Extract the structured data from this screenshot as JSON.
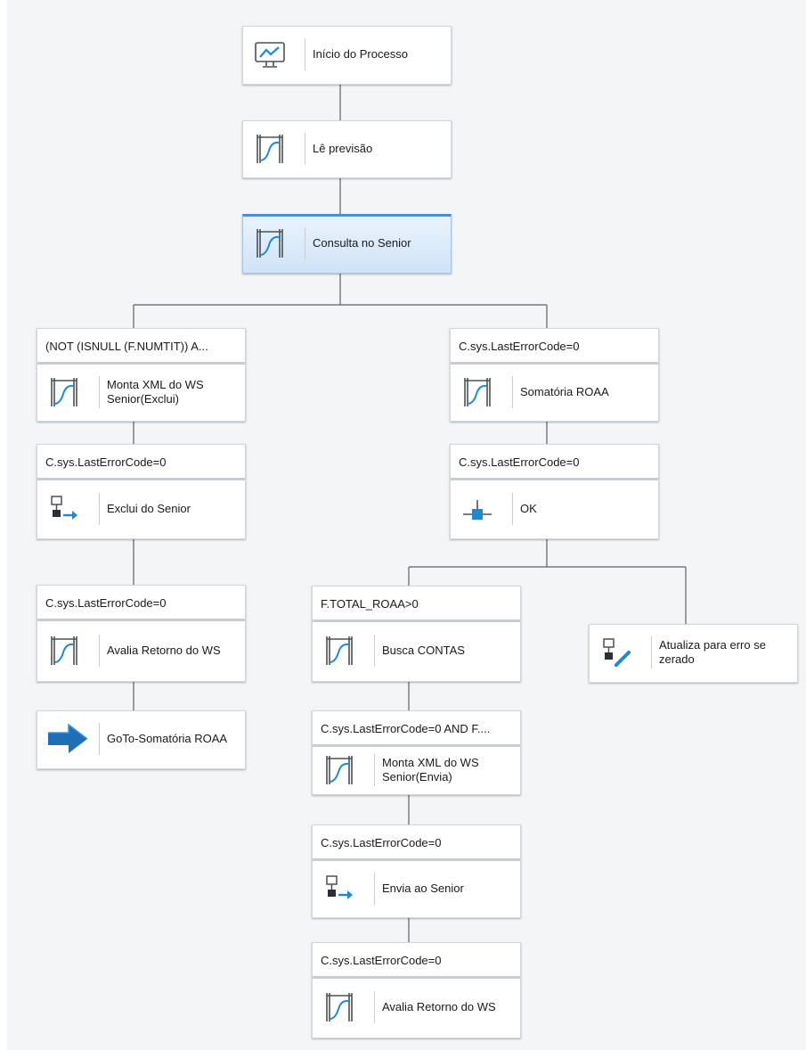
{
  "nodes": {
    "start": {
      "label": "Início do Processo",
      "icon": "monitor-chart-icon"
    },
    "le_previsao": {
      "label": "Lê previsão",
      "icon": "sql-gate-icon"
    },
    "consulta_senior": {
      "label": "Consulta no Senior",
      "icon": "sql-gate-icon"
    },
    "monta_xml_exclui": {
      "condition": "(NOT (ISNULL (F.NUMTIT)) A...",
      "label": "Monta XML do WS Senior(Exclui)",
      "icon": "sql-gate-icon"
    },
    "exclui_senior": {
      "condition": "C.sys.LastErrorCode=0",
      "label": "Exclui do Senior",
      "icon": "call-flow-icon"
    },
    "avalia_retorno_left": {
      "condition": "C.sys.LastErrorCode=0",
      "label": "Avalia Retorno do WS",
      "icon": "sql-gate-icon"
    },
    "goto_somatoria": {
      "label": "GoTo-Somatória ROAA",
      "icon": "goto-arrow-icon"
    },
    "somatoria_roaa": {
      "condition": "C.sys.LastErrorCode=0",
      "label": "Somatória ROAA",
      "icon": "sql-gate-icon"
    },
    "ok": {
      "condition": "C.sys.LastErrorCode=0",
      "label": "OK",
      "icon": "junction-icon"
    },
    "busca_contas": {
      "condition": "F.TOTAL_ROAA>0",
      "label": "Busca CONTAS",
      "icon": "sql-gate-icon"
    },
    "atualiza_erro": {
      "label": "Atualiza para erro se zerado",
      "icon": "edit-flow-icon"
    },
    "monta_xml_envia": {
      "condition": "C.sys.LastErrorCode=0 AND F....",
      "label": "Monta XML do WS Senior(Envia)",
      "icon": "sql-gate-icon"
    },
    "envia_senior": {
      "condition": "C.sys.LastErrorCode=0",
      "label": "Envia ao Senior",
      "icon": "call-flow-icon"
    },
    "avalia_retorno_bottom": {
      "condition": "C.sys.LastErrorCode=0",
      "label": "Avalia Retorno do WS",
      "icon": "sql-gate-icon"
    }
  },
  "colors": {
    "selected_accent": "#4a90d9",
    "icon_blue": "#1e88d8",
    "connector": "#5a5f66"
  }
}
